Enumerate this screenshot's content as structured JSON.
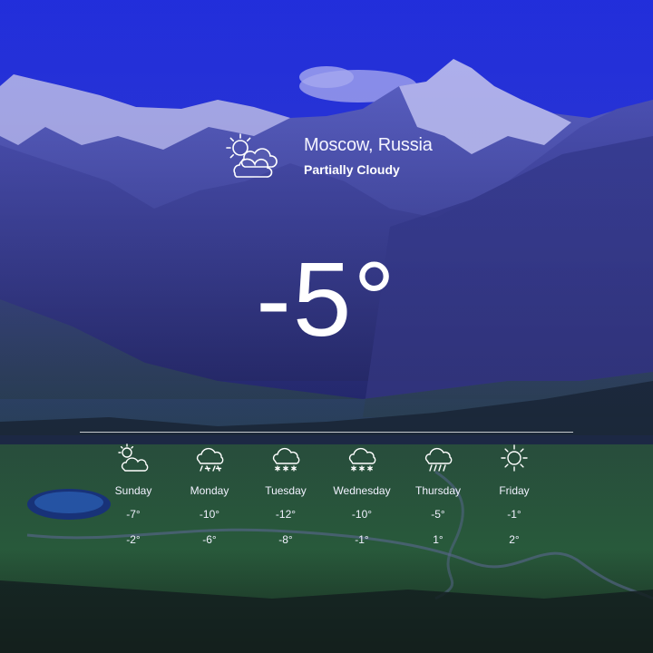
{
  "location": "Moscow, Russia",
  "condition": "Partially Cloudy",
  "temperature": "-5°",
  "current_icon": "sun-behind-cloud-icon",
  "forecast": [
    {
      "day": "Sunday",
      "high": "-7°",
      "low": "-2°",
      "icon": "partly-cloudy-icon"
    },
    {
      "day": "Monday",
      "high": "-10°",
      "low": "-6°",
      "icon": "sleet-cloud-icon"
    },
    {
      "day": "Tuesday",
      "high": "-12°",
      "low": "-8°",
      "icon": "snow-cloud-icon"
    },
    {
      "day": "Wednesday",
      "high": "-10°",
      "low": "-1°",
      "icon": "snow-cloud-icon"
    },
    {
      "day": "Thursday",
      "high": "-5°",
      "low": "1°",
      "icon": "rain-cloud-icon"
    },
    {
      "day": "Friday",
      "high": "-1°",
      "low": "2°",
      "icon": "sun-icon"
    }
  ],
  "colors": {
    "sky": "#2431d9",
    "mountain": "#4a4f9e",
    "meadow": "#2f6b3a",
    "text": "#ffffff"
  }
}
